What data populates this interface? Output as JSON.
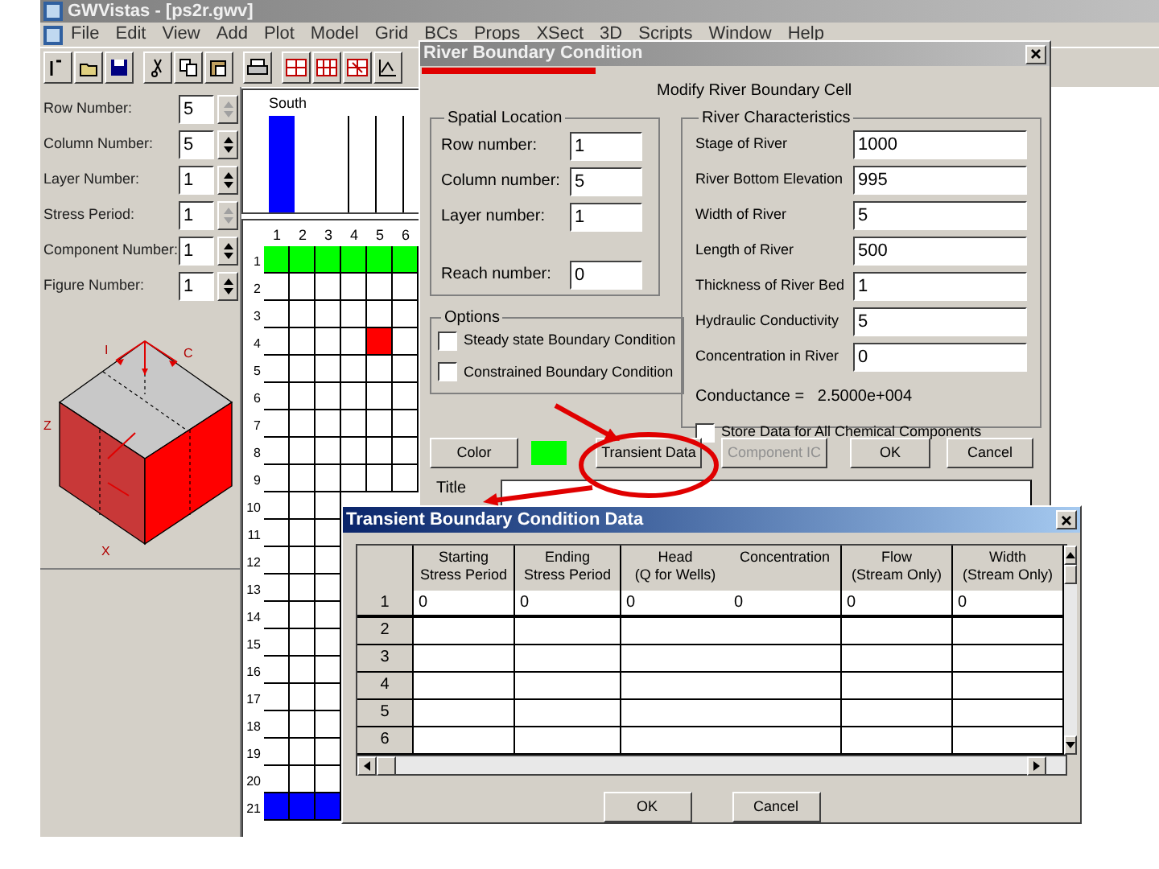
{
  "app": {
    "title": "GWVistas - [ps2r.gwv]",
    "menu": [
      "File",
      "Edit",
      "View",
      "Add",
      "Plot",
      "Model",
      "Grid",
      "BCs",
      "Props",
      "XSect",
      "3D",
      "Scripts",
      "Window",
      "Help"
    ]
  },
  "controls": [
    {
      "label": "Row Number:",
      "value": "5",
      "disabled": true
    },
    {
      "label": "Column Number:",
      "value": "5",
      "disabled": false
    },
    {
      "label": "Layer Number:",
      "value": "1",
      "disabled": false
    },
    {
      "label": "Stress Period:",
      "value": "1",
      "disabled": true
    },
    {
      "label": "Component Number:",
      "value": "1",
      "disabled": false
    },
    {
      "label": "Figure Number:",
      "value": "1",
      "disabled": false
    }
  ],
  "cube_labels": [
    "I",
    "C",
    "Z",
    "X"
  ],
  "profile": {
    "label": "South"
  },
  "grid": {
    "columns": [
      "1",
      "2",
      "3",
      "4",
      "5",
      "6"
    ],
    "rows": [
      {
        "label": "1",
        "cells": [
          {
            "color": "#00ff00"
          },
          {
            "color": "#00ff00"
          },
          {
            "color": "#00ff00"
          },
          {
            "color": "#00ff00"
          },
          {
            "color": "#00ff00"
          },
          {
            "color": "#00ff00"
          }
        ]
      },
      {
        "label": "2"
      },
      {
        "label": "3"
      },
      {
        "label": "4",
        "cells": [
          null,
          null,
          null,
          null,
          {
            "color": "#ff0000"
          }
        ]
      },
      {
        "label": "5"
      },
      {
        "label": "6"
      },
      {
        "label": "7"
      },
      {
        "label": "8"
      },
      {
        "label": "9"
      },
      {
        "label": "10"
      },
      {
        "label": "11"
      },
      {
        "label": "12"
      },
      {
        "label": "13"
      },
      {
        "label": "14"
      },
      {
        "label": "15"
      },
      {
        "label": "16"
      },
      {
        "label": "17"
      },
      {
        "label": "18"
      },
      {
        "label": "19"
      },
      {
        "label": "20"
      },
      {
        "label": "21",
        "cells": [
          {
            "color": "#0000ff"
          },
          {
            "color": "#0000ff"
          },
          {
            "color": "#0000ff"
          }
        ]
      }
    ]
  },
  "river_dialog": {
    "title": "River Boundary Condition",
    "heading": "Modify River Boundary Cell",
    "spatial_location": {
      "title": "Spatial Location",
      "fields": [
        {
          "label": "Row number:",
          "value": "1"
        },
        {
          "label": "Column number:",
          "value": "5"
        },
        {
          "label": "Layer number:",
          "value": "1"
        },
        {
          "label": "Reach number:",
          "value": "0"
        }
      ]
    },
    "options": {
      "title": "Options",
      "items": [
        {
          "label": "Steady state Boundary Condition",
          "checked": false
        },
        {
          "label": "Constrained Boundary Condition",
          "checked": false
        }
      ]
    },
    "river_characteristics": {
      "title": "River Characteristics",
      "fields": [
        {
          "label": "Stage of River",
          "value": "1000"
        },
        {
          "label": "River Bottom Elevation",
          "value": "995"
        },
        {
          "label": "Width of River",
          "value": "5"
        },
        {
          "label": "Length of River",
          "value": "500"
        },
        {
          "label": "Thickness of River Bed",
          "value": "1"
        },
        {
          "label": "Hydraulic Conductivity",
          "value": "5"
        },
        {
          "label": "Concentration in River",
          "value": "0"
        }
      ],
      "conductance": "Conductance =   2.5000e+004",
      "store_all": {
        "label": "Store Data for All Chemical Components",
        "checked": false
      }
    },
    "color_button": "Color",
    "swatch": {
      "color": "#00ff00"
    },
    "buttons": [
      {
        "label": "Transient Data",
        "disabled": false
      },
      {
        "label": "Component IC",
        "disabled": true
      },
      {
        "label": "OK",
        "disabled": false
      },
      {
        "label": "Cancel",
        "disabled": false
      }
    ],
    "title_label": "Title"
  },
  "transient_dialog": {
    "title": "Transient Boundary Condition Data",
    "columns": [
      {
        "lines": [
          "Starting",
          "Stress Period"
        ]
      },
      {
        "lines": [
          "Ending",
          "Stress Period"
        ]
      },
      {
        "lines": [
          "Head",
          "(Q for Wells)"
        ]
      },
      {
        "lines": [
          "Concentration"
        ]
      },
      {
        "lines": [
          "Flow",
          "(Stream Only)"
        ]
      },
      {
        "lines": [
          "Width",
          "(Stream Only)"
        ]
      }
    ],
    "rows": [
      {
        "label": "1",
        "values": [
          "0",
          "0",
          "0",
          "0",
          "0",
          "0"
        ]
      },
      {
        "label": "2"
      },
      {
        "label": "3"
      },
      {
        "label": "4"
      },
      {
        "label": "5"
      },
      {
        "label": "6"
      }
    ],
    "buttons": [
      "OK",
      "Cancel"
    ]
  }
}
